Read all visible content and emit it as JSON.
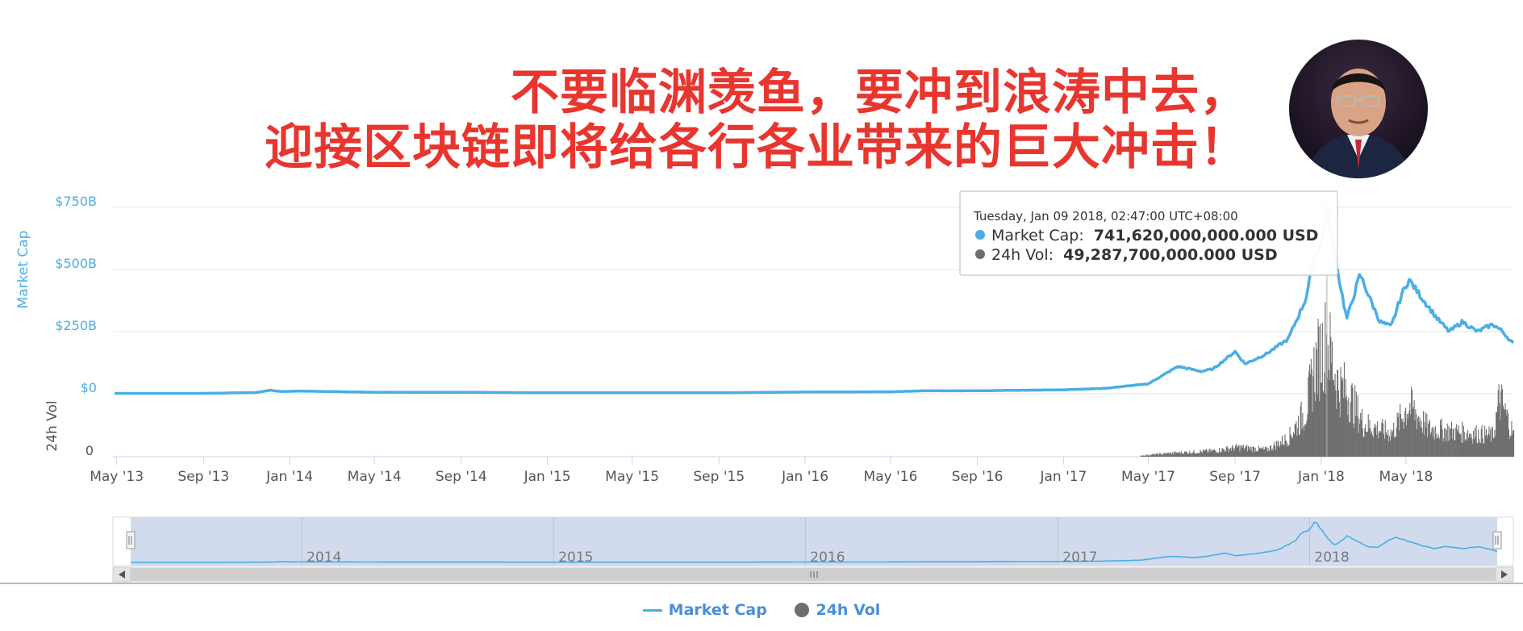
{
  "headline": {
    "line1": "不要临渊羡鱼，要冲到浪涛中去，",
    "line2": "迎接区块链即将给各行各业带来的巨大冲击！"
  },
  "chart_data": {
    "type": "line",
    "title": "",
    "ylabel": "Market Cap",
    "ylabel2": "24h Vol",
    "yticks": [
      "$0",
      "$250B",
      "$500B",
      "$750B"
    ],
    "ylim": [
      0,
      750
    ],
    "y_units": "billion USD",
    "vol_ticks": [
      "0"
    ],
    "xticks": [
      "May '13",
      "Sep '13",
      "Jan '14",
      "May '14",
      "Sep '14",
      "Jan '15",
      "May '15",
      "Sep '15",
      "Jan '16",
      "May '16",
      "Sep '16",
      "Jan '17",
      "May '17",
      "Sep '17",
      "Jan '18",
      "May '18"
    ],
    "x_range": [
      "2013-04-28",
      "2018-09-30"
    ],
    "series": [
      {
        "name": "Market Cap",
        "color": "#4aaee4",
        "points": [
          [
            "2013-04-28",
            1.6
          ],
          [
            "2013-09-01",
            1.6
          ],
          [
            "2013-11-15",
            5
          ],
          [
            "2013-12-04",
            14
          ],
          [
            "2013-12-20",
            9
          ],
          [
            "2014-01-15",
            11
          ],
          [
            "2014-05-01",
            6
          ],
          [
            "2014-09-01",
            6
          ],
          [
            "2015-01-01",
            4
          ],
          [
            "2015-05-01",
            4
          ],
          [
            "2015-09-01",
            4
          ],
          [
            "2016-01-01",
            7
          ],
          [
            "2016-05-01",
            8
          ],
          [
            "2016-06-20",
            12
          ],
          [
            "2016-09-01",
            12
          ],
          [
            "2017-01-01",
            16
          ],
          [
            "2017-03-01",
            22
          ],
          [
            "2017-05-01",
            40
          ],
          [
            "2017-06-12",
            110
          ],
          [
            "2017-07-15",
            90
          ],
          [
            "2017-08-01",
            100
          ],
          [
            "2017-09-01",
            170
          ],
          [
            "2017-09-15",
            120
          ],
          [
            "2017-10-15",
            160
          ],
          [
            "2017-11-15",
            220
          ],
          [
            "2017-12-10",
            380
          ],
          [
            "2017-12-22",
            550
          ],
          [
            "2018-01-01",
            600
          ],
          [
            "2018-01-09",
            741.62
          ],
          [
            "2018-01-20",
            560
          ],
          [
            "2018-02-06",
            300
          ],
          [
            "2018-02-25",
            480
          ],
          [
            "2018-03-10",
            390
          ],
          [
            "2018-03-25",
            290
          ],
          [
            "2018-04-10",
            270
          ],
          [
            "2018-04-25",
            400
          ],
          [
            "2018-05-05",
            460
          ],
          [
            "2018-05-25",
            380
          ],
          [
            "2018-06-15",
            300
          ],
          [
            "2018-07-01",
            250
          ],
          [
            "2018-07-20",
            290
          ],
          [
            "2018-08-10",
            250
          ],
          [
            "2018-09-01",
            280
          ],
          [
            "2018-09-15",
            250
          ],
          [
            "2018-09-30",
            200
          ]
        ]
      },
      {
        "name": "24h Vol",
        "color": "#6e6e6e",
        "points": [
          [
            "2017-04-20",
            0.5
          ],
          [
            "2017-06-01",
            1.5
          ],
          [
            "2017-08-01",
            2.5
          ],
          [
            "2017-09-05",
            4
          ],
          [
            "2017-10-15",
            3
          ],
          [
            "2017-11-15",
            8
          ],
          [
            "2017-12-10",
            20
          ],
          [
            "2017-12-22",
            38
          ],
          [
            "2018-01-05",
            48
          ],
          [
            "2018-01-09",
            49.29
          ],
          [
            "2018-01-25",
            30
          ],
          [
            "2018-02-06",
            28
          ],
          [
            "2018-03-01",
            14
          ],
          [
            "2018-04-10",
            10
          ],
          [
            "2018-05-05",
            22
          ],
          [
            "2018-06-01",
            12
          ],
          [
            "2018-07-01",
            11
          ],
          [
            "2018-08-01",
            10
          ],
          [
            "2018-09-01",
            9
          ],
          [
            "2018-09-10",
            25
          ],
          [
            "2018-09-30",
            9
          ]
        ]
      }
    ],
    "navigator": {
      "years": [
        "2014",
        "2015",
        "2016",
        "2017",
        "2018"
      ]
    },
    "tooltip": {
      "date": "Tuesday, Jan 09 2018, 02:47:00 UTC+08:00",
      "items": [
        {
          "label": "Market Cap:",
          "value": "741,620,000,000.000 USD",
          "color": "#4aaee4"
        },
        {
          "label": "24h Vol:",
          "value": "49,287,700,000.000 USD",
          "color": "#6e6e6e"
        }
      ]
    },
    "legend": {
      "placement": "bottom-center",
      "items": [
        "Market Cap",
        "24h Vol"
      ]
    }
  }
}
